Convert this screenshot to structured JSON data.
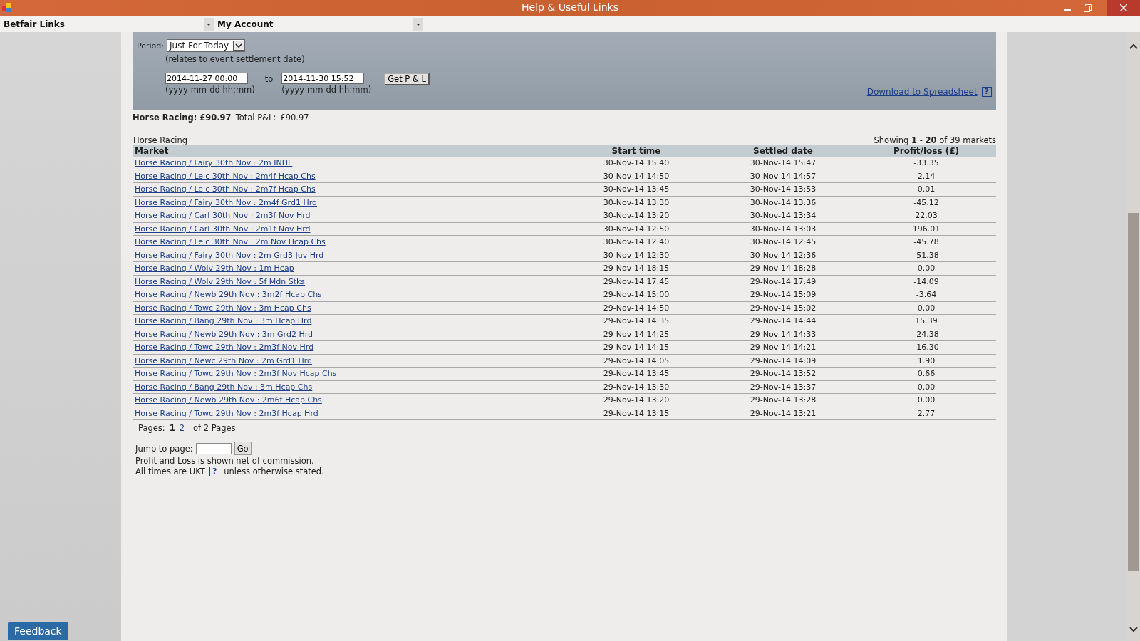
{
  "window": {
    "title": "Help & Useful Links"
  },
  "toolbar": [
    {
      "label": "Betfair Links"
    },
    {
      "label": "My Account"
    }
  ],
  "filter": {
    "period_label": "Period:",
    "period_value": "Just For Today",
    "period_note": "(relates to event settlement date)",
    "from_value": "2014-11-27 00:00",
    "to_label": "to",
    "to_value": "2014-11-30 15:52",
    "from_hint": "(yyyy-mm-dd hh:mm)",
    "to_hint": "(yyyy-mm-dd hh:mm)",
    "button": "Get P & L",
    "download_link": "Download to Spreadsheet",
    "help": "?"
  },
  "summary": {
    "sport_total": "Horse Racing: £90.97",
    "total_label": "Total P&L:",
    "total_value": "£90.97"
  },
  "table": {
    "caption": "Horse Racing",
    "showing": "Showing **1** - **20** of 39 markets",
    "columns": [
      "Market",
      "Start time",
      "Settled date",
      "Profit/loss (£)"
    ],
    "rows": [
      [
        "Horse Racing / Fairy 30th Nov : 2m INHF",
        "30-Nov-14 15:40",
        "30-Nov-14 15:47",
        "-33.35"
      ],
      [
        "Horse Racing / Leic 30th Nov : 2m4f Hcap Chs",
        "30-Nov-14 14:50",
        "30-Nov-14 14:57",
        "2.14"
      ],
      [
        "Horse Racing / Leic 30th Nov : 2m7f Hcap Chs",
        "30-Nov-14 13:45",
        "30-Nov-14 13:53",
        "0.01"
      ],
      [
        "Horse Racing / Fairy 30th Nov : 2m4f Grd1 Hrd",
        "30-Nov-14 13:30",
        "30-Nov-14 13:36",
        "-45.12"
      ],
      [
        "Horse Racing / Carl 30th Nov : 2m3f Nov Hrd",
        "30-Nov-14 13:20",
        "30-Nov-14 13:34",
        "22.03"
      ],
      [
        "Horse Racing / Carl 30th Nov : 2m1f Nov Hrd",
        "30-Nov-14 12:50",
        "30-Nov-14 13:03",
        "196.01"
      ],
      [
        "Horse Racing / Leic 30th Nov : 2m Nov Hcap Chs",
        "30-Nov-14 12:40",
        "30-Nov-14 12:45",
        "-45.78"
      ],
      [
        "Horse Racing / Fairy 30th Nov : 2m Grd3 Juv Hrd",
        "30-Nov-14 12:30",
        "30-Nov-14 12:36",
        "-51.38"
      ],
      [
        "Horse Racing / Wolv 29th Nov : 1m Hcap",
        "29-Nov-14 18:15",
        "29-Nov-14 18:28",
        "0.00"
      ],
      [
        "Horse Racing / Wolv 29th Nov : 5f Mdn Stks",
        "29-Nov-14 17:45",
        "29-Nov-14 17:49",
        "-14.09"
      ],
      [
        "Horse Racing / Newb 29th Nov : 3m2f Hcap Chs",
        "29-Nov-14 15:00",
        "29-Nov-14 15:09",
        "-3.64"
      ],
      [
        "Horse Racing / Towc 29th Nov : 3m Hcap Chs",
        "29-Nov-14 14:50",
        "29-Nov-14 15:02",
        "0.00"
      ],
      [
        "Horse Racing / Bang 29th Nov : 3m Hcap Hrd",
        "29-Nov-14 14:35",
        "29-Nov-14 14:44",
        "15.39"
      ],
      [
        "Horse Racing / Newb 29th Nov : 3m Grd2 Hrd",
        "29-Nov-14 14:25",
        "29-Nov-14 14:33",
        "-24.38"
      ],
      [
        "Horse Racing / Towc 29th Nov : 2m3f Nov Hrd",
        "29-Nov-14 14:15",
        "29-Nov-14 14:21",
        "-16.30"
      ],
      [
        "Horse Racing / Newc 29th Nov : 2m Grd1 Hrd",
        "29-Nov-14 14:05",
        "29-Nov-14 14:09",
        "1.90"
      ],
      [
        "Horse Racing / Towc 29th Nov : 2m3f Nov Hcap Chs",
        "29-Nov-14 13:45",
        "29-Nov-14 13:52",
        "0.66"
      ],
      [
        "Horse Racing / Bang 29th Nov : 3m Hcap Chs",
        "29-Nov-14 13:30",
        "29-Nov-14 13:37",
        "0.00"
      ],
      [
        "Horse Racing / Newb 29th Nov : 2m6f Hcap Chs",
        "29-Nov-14 13:20",
        "29-Nov-14 13:28",
        "0.00"
      ],
      [
        "Horse Racing / Towc 29th Nov : 2m3f Hcap Hrd",
        "29-Nov-14 13:15",
        "29-Nov-14 13:21",
        "2.77"
      ]
    ]
  },
  "pagination": {
    "label": "Pages:",
    "pages": [
      {
        "label": "1",
        "selected": true
      },
      {
        "label": "2",
        "selected": false
      }
    ],
    "suffix": "of 2 Pages"
  },
  "footer": {
    "jump_label": "Jump to page:",
    "go": "Go",
    "note": "Profit and Loss is shown net of commission.",
    "tz_before": "All times are UKT",
    "help": "?",
    "tz_after": "unless otherwise stated."
  },
  "feedback": "Feedback"
}
